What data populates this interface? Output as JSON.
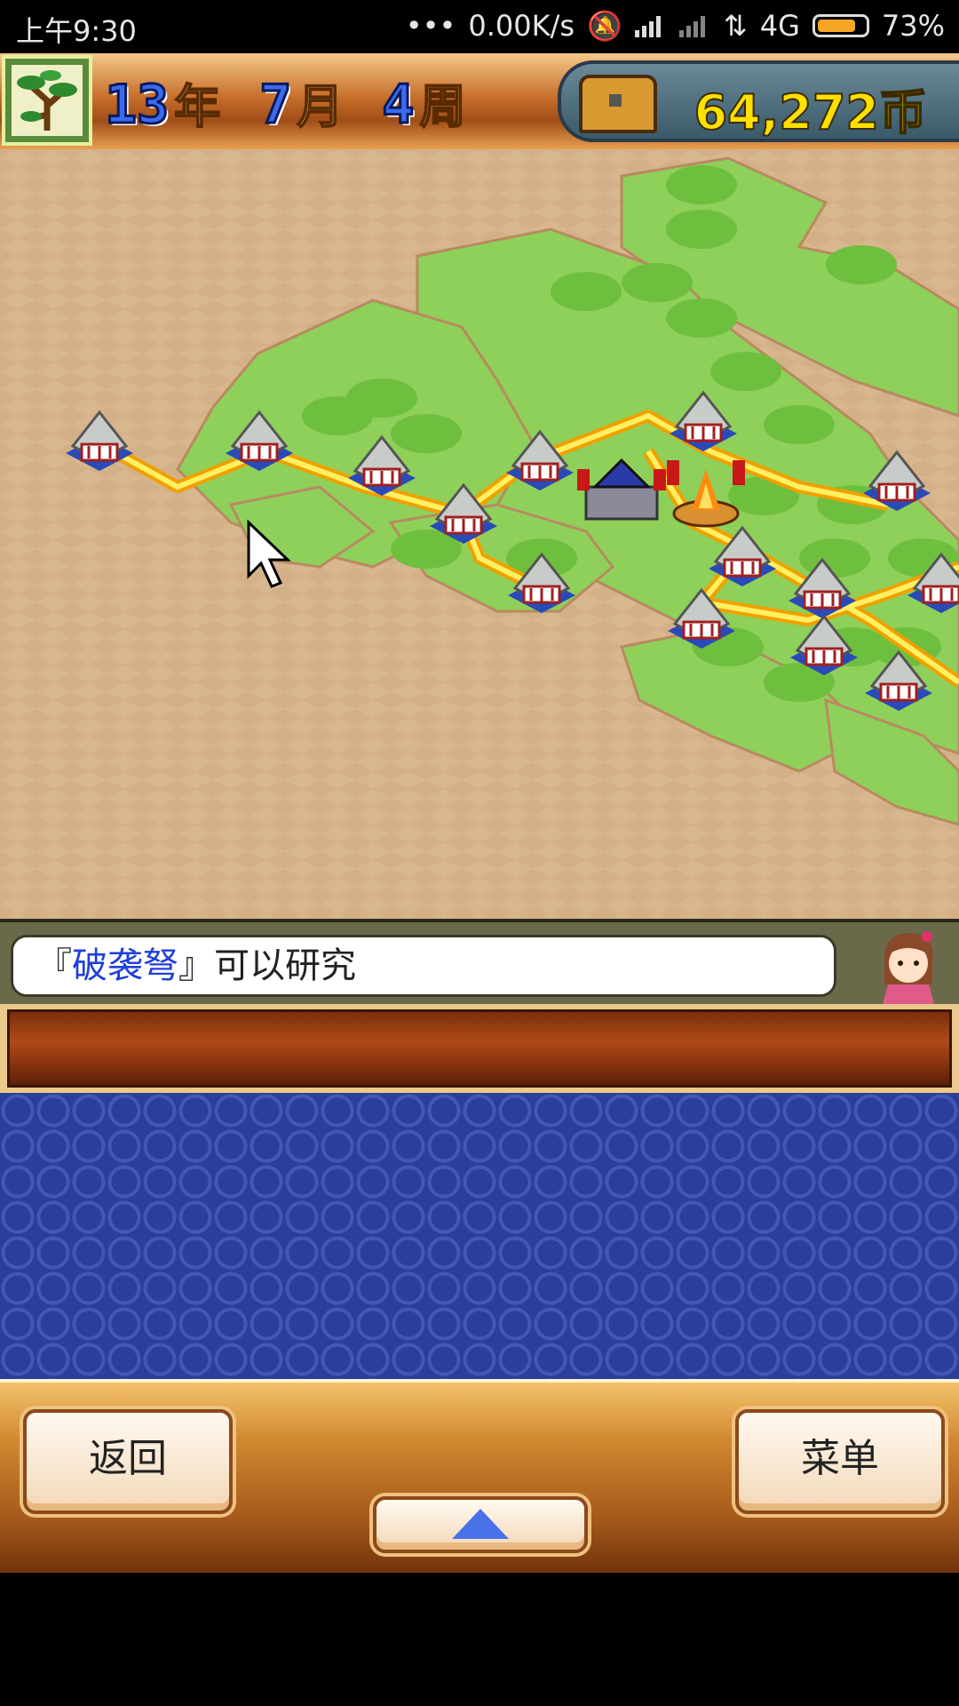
{
  "status_bar": {
    "time": "上午9:30",
    "dots": "•••",
    "net_speed": "0.00K/s",
    "network": "4G",
    "battery": "73%"
  },
  "header": {
    "year_num": "13",
    "year_unit": "年",
    "month_num": "7",
    "month_unit": "月",
    "week_num": "4",
    "week_unit": "周",
    "money": "64,272币",
    "icons": [
      "tree-icon",
      "treasure-chest-icon"
    ]
  },
  "message": {
    "open_bracket": "『",
    "highlight": "破袭弩",
    "close_bracket": "』",
    "text": "可以研究",
    "highlight_color": "#1f3fd8"
  },
  "buttons": {
    "back_label": "返回",
    "menu_label": "菜单",
    "up_icon": "up-arrow-icon"
  },
  "map": {
    "icons": [
      "village-icon",
      "castle-icon",
      "campfire-icon",
      "cursor-icon"
    ]
  }
}
